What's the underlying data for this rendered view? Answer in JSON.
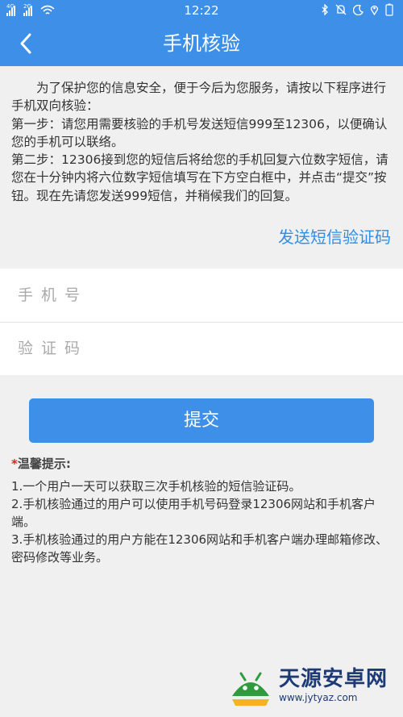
{
  "status_bar": {
    "network_left": "4G",
    "network_right": "2G",
    "time": "12:22"
  },
  "header": {
    "title": "手机核验"
  },
  "intro": {
    "para1": "为了保护您的信息安全，便于今后为您服务，请按以下程序进行手机双向核验：",
    "para2": "第一步：请您用需要核验的手机号发送短信999至12306，以便确认您的手机可以联络。",
    "para3": "第二步：12306接到您的短信后将给您的手机回复六位数字短信，请您在十分钟内将六位数字短信填写在下方空白框中，并点击“提交”按钮。现在先请您发送999短信，并稍候我们的回复。"
  },
  "send_code_label": "发送短信验证码",
  "form": {
    "phone_placeholder": "手机号",
    "phone_value": "",
    "code_placeholder": "验证码",
    "code_value": ""
  },
  "submit_label": "提交",
  "tips": {
    "star": "*",
    "title": "温馨提示:",
    "items": [
      "1.一个用户一天可以获取三次手机核验的短信验证码。",
      "2.手机核验通过的用户可以使用手机号码登录12306网站和手机客户端。",
      "3.手机核验通过的用户方能在12306网站和手机客户端办理邮箱修改、密码修改等业务。"
    ]
  },
  "watermark": {
    "name": "天源安卓网",
    "url": "www.jytyaz.com"
  },
  "colors": {
    "primary": "#3d8fe8",
    "link": "#2f8fe6",
    "star": "#e02020",
    "background": "#f0f0f0"
  },
  "icons": {
    "back": "chevron-left-icon",
    "bluetooth": "bluetooth-icon",
    "alarm": "alarm-off-icon",
    "moon": "moon-icon",
    "location": "location-icon",
    "wifi": "wifi-icon"
  }
}
